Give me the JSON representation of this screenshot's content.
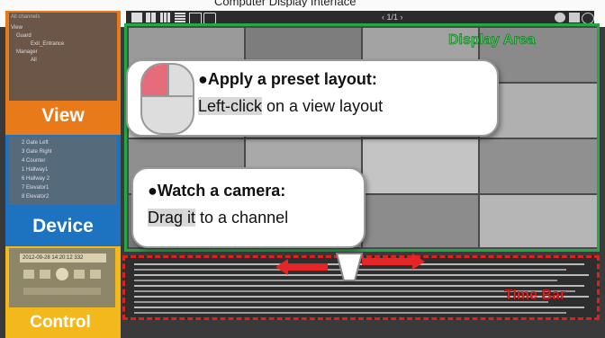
{
  "window_title": "Computer Display Interface",
  "toolbar": {
    "page": "1/1",
    "layout_icons": [
      "layout-1x1-icon",
      "layout-2x2-icon",
      "layout-3x3-icon",
      "layout-4x4-icon",
      "layout-custom-icon",
      "layout-fullscreen-icon"
    ],
    "right_icons": [
      "gear-icon",
      "snapshot-icon",
      "info-icon"
    ]
  },
  "view_panel": {
    "header": "All channels",
    "section": "View",
    "tree": [
      {
        "label": "Guard"
      },
      {
        "label": "Exit_Entrance"
      },
      {
        "label": "Manager"
      },
      {
        "label": "All"
      }
    ],
    "label": "View"
  },
  "device_panel": {
    "items": [
      "2 Gate Left",
      "3 Gate Right",
      "4 Counter",
      "1 Hallway1",
      "6 Hallway 2",
      "7 Elevator1",
      "8 Elevator2"
    ],
    "label": "Device"
  },
  "control_panel": {
    "datetime": "2012-09-28 14:20:12 332",
    "label": "Control"
  },
  "display_area": {
    "label": "Display Area"
  },
  "time_bar": {
    "label": "Time Bar"
  },
  "callout_layout": {
    "title": "●Apply a preset layout:",
    "highlight": "Left-click",
    "rest": " on a view layout"
  },
  "callout_camera": {
    "title": "●Watch a camera:",
    "highlight": "Drag it",
    "rest": " to a channel"
  },
  "colors": {
    "view": "#e87a1a",
    "device": "#1e73c0",
    "control": "#f3b81b",
    "display_border": "#22a845",
    "timebar_border": "#e02020"
  }
}
